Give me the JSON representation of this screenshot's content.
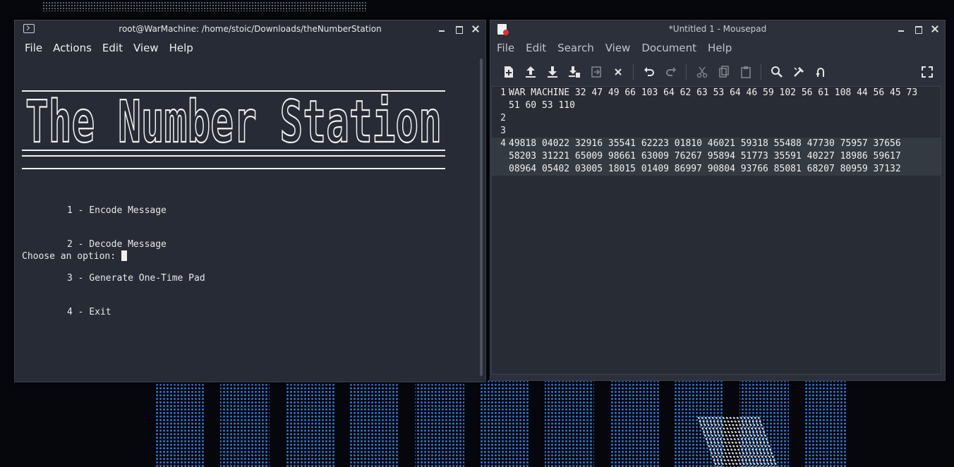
{
  "terminal": {
    "title": "root@WarMachine: /home/stoic/Downloads/theNumberStation",
    "menu": [
      "File",
      "Actions",
      "Edit",
      "View",
      "Help"
    ],
    "banner_text": "The Number Station",
    "options": [
      "1 - Encode Message",
      "2 - Decode Message",
      "3 - Generate One-Time Pad",
      "4 - Exit"
    ],
    "prompt": "Choose an option: "
  },
  "mousepad": {
    "title": "*Untitled 1 - Mousepad",
    "menu": [
      "File",
      "Edit",
      "Search",
      "View",
      "Document",
      "Help"
    ],
    "toolbar_icons": [
      "new-document-icon",
      "open-icon",
      "save-icon",
      "save-as-icon",
      "reload-icon",
      "close-tab-icon",
      "undo-icon",
      "redo-icon",
      "cut-icon",
      "copy-icon",
      "paste-icon",
      "find-icon",
      "find-replace-icon",
      "goto-icon",
      "fullscreen-icon"
    ],
    "lines": [
      {
        "num": "1",
        "text": "WAR MACHINE 32 47 49 66 103 64 62 63 53 64 46 59 102 56 61 108 44 56 45 73 51 60 53 110"
      },
      {
        "num": "2",
        "text": ""
      },
      {
        "num": "3",
        "text": ""
      },
      {
        "num": "4",
        "text": "49818 04022 32916 35541 62223 01810 46021 59318 55488 47730 75957 37656 58203 31221 65009 98661 63009 76267 95894 51773 35591 40227 18986 59617 08964 05402 03005 18015 01409 86997 90804 93766 85081 68207 80959 37132"
      }
    ],
    "current_line": "4"
  }
}
